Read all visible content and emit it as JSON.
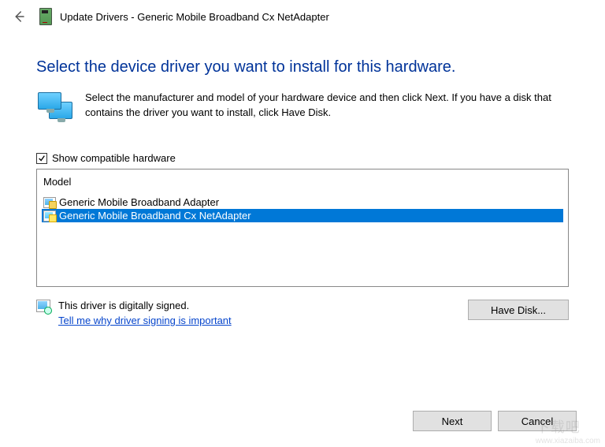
{
  "header": {
    "title": "Update Drivers - Generic Mobile Broadband Cx NetAdapter"
  },
  "main": {
    "heading": "Select the device driver you want to install for this hardware.",
    "intro": "Select the manufacturer and model of your hardware device and then click Next. If you have a disk that contains the driver you want to install, click Have Disk."
  },
  "checkbox": {
    "label": "Show compatible hardware",
    "checked": true
  },
  "modelList": {
    "header": "Model",
    "items": [
      {
        "label": "Generic Mobile Broadband Adapter",
        "selected": false
      },
      {
        "label": "Generic Mobile Broadband Cx NetAdapter",
        "selected": true
      }
    ]
  },
  "signing": {
    "statusLine": "This driver is digitally signed.",
    "helpLink": "Tell me why driver signing is important"
  },
  "buttons": {
    "haveDisk": "Have Disk...",
    "next": "Next",
    "cancel": "Cancel"
  },
  "watermark": {
    "big": "下载吧",
    "small": "www.xiazaiba.com"
  }
}
